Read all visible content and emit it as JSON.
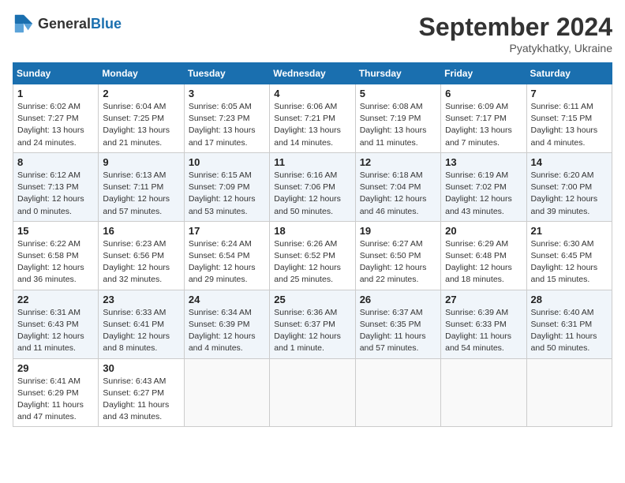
{
  "header": {
    "logo_general": "General",
    "logo_blue": "Blue",
    "month_year": "September 2024",
    "location": "Pyatykhatky, Ukraine"
  },
  "days_of_week": [
    "Sunday",
    "Monday",
    "Tuesday",
    "Wednesday",
    "Thursday",
    "Friday",
    "Saturday"
  ],
  "weeks": [
    [
      {
        "day": "1",
        "sunrise": "6:02 AM",
        "sunset": "7:27 PM",
        "daylight": "13 hours and 24 minutes."
      },
      {
        "day": "2",
        "sunrise": "6:04 AM",
        "sunset": "7:25 PM",
        "daylight": "13 hours and 21 minutes."
      },
      {
        "day": "3",
        "sunrise": "6:05 AM",
        "sunset": "7:23 PM",
        "daylight": "13 hours and 17 minutes."
      },
      {
        "day": "4",
        "sunrise": "6:06 AM",
        "sunset": "7:21 PM",
        "daylight": "13 hours and 14 minutes."
      },
      {
        "day": "5",
        "sunrise": "6:08 AM",
        "sunset": "7:19 PM",
        "daylight": "13 hours and 11 minutes."
      },
      {
        "day": "6",
        "sunrise": "6:09 AM",
        "sunset": "7:17 PM",
        "daylight": "13 hours and 7 minutes."
      },
      {
        "day": "7",
        "sunrise": "6:11 AM",
        "sunset": "7:15 PM",
        "daylight": "13 hours and 4 minutes."
      }
    ],
    [
      {
        "day": "8",
        "sunrise": "6:12 AM",
        "sunset": "7:13 PM",
        "daylight": "12 hours and 0 minutes."
      },
      {
        "day": "9",
        "sunrise": "6:13 AM",
        "sunset": "7:11 PM",
        "daylight": "12 hours and 57 minutes."
      },
      {
        "day": "10",
        "sunrise": "6:15 AM",
        "sunset": "7:09 PM",
        "daylight": "12 hours and 53 minutes."
      },
      {
        "day": "11",
        "sunrise": "6:16 AM",
        "sunset": "7:06 PM",
        "daylight": "12 hours and 50 minutes."
      },
      {
        "day": "12",
        "sunrise": "6:18 AM",
        "sunset": "7:04 PM",
        "daylight": "12 hours and 46 minutes."
      },
      {
        "day": "13",
        "sunrise": "6:19 AM",
        "sunset": "7:02 PM",
        "daylight": "12 hours and 43 minutes."
      },
      {
        "day": "14",
        "sunrise": "6:20 AM",
        "sunset": "7:00 PM",
        "daylight": "12 hours and 39 minutes."
      }
    ],
    [
      {
        "day": "15",
        "sunrise": "6:22 AM",
        "sunset": "6:58 PM",
        "daylight": "12 hours and 36 minutes."
      },
      {
        "day": "16",
        "sunrise": "6:23 AM",
        "sunset": "6:56 PM",
        "daylight": "12 hours and 32 minutes."
      },
      {
        "day": "17",
        "sunrise": "6:24 AM",
        "sunset": "6:54 PM",
        "daylight": "12 hours and 29 minutes."
      },
      {
        "day": "18",
        "sunrise": "6:26 AM",
        "sunset": "6:52 PM",
        "daylight": "12 hours and 25 minutes."
      },
      {
        "day": "19",
        "sunrise": "6:27 AM",
        "sunset": "6:50 PM",
        "daylight": "12 hours and 22 minutes."
      },
      {
        "day": "20",
        "sunrise": "6:29 AM",
        "sunset": "6:48 PM",
        "daylight": "12 hours and 18 minutes."
      },
      {
        "day": "21",
        "sunrise": "6:30 AM",
        "sunset": "6:45 PM",
        "daylight": "12 hours and 15 minutes."
      }
    ],
    [
      {
        "day": "22",
        "sunrise": "6:31 AM",
        "sunset": "6:43 PM",
        "daylight": "12 hours and 11 minutes."
      },
      {
        "day": "23",
        "sunrise": "6:33 AM",
        "sunset": "6:41 PM",
        "daylight": "12 hours and 8 minutes."
      },
      {
        "day": "24",
        "sunrise": "6:34 AM",
        "sunset": "6:39 PM",
        "daylight": "12 hours and 4 minutes."
      },
      {
        "day": "25",
        "sunrise": "6:36 AM",
        "sunset": "6:37 PM",
        "daylight": "12 hours and 1 minute."
      },
      {
        "day": "26",
        "sunrise": "6:37 AM",
        "sunset": "6:35 PM",
        "daylight": "11 hours and 57 minutes."
      },
      {
        "day": "27",
        "sunrise": "6:39 AM",
        "sunset": "6:33 PM",
        "daylight": "11 hours and 54 minutes."
      },
      {
        "day": "28",
        "sunrise": "6:40 AM",
        "sunset": "6:31 PM",
        "daylight": "11 hours and 50 minutes."
      }
    ],
    [
      {
        "day": "29",
        "sunrise": "6:41 AM",
        "sunset": "6:29 PM",
        "daylight": "11 hours and 47 minutes."
      },
      {
        "day": "30",
        "sunrise": "6:43 AM",
        "sunset": "6:27 PM",
        "daylight": "11 hours and 43 minutes."
      },
      null,
      null,
      null,
      null,
      null
    ]
  ],
  "labels": {
    "sunrise": "Sunrise:",
    "sunset": "Sunset:",
    "daylight": "Daylight:"
  }
}
